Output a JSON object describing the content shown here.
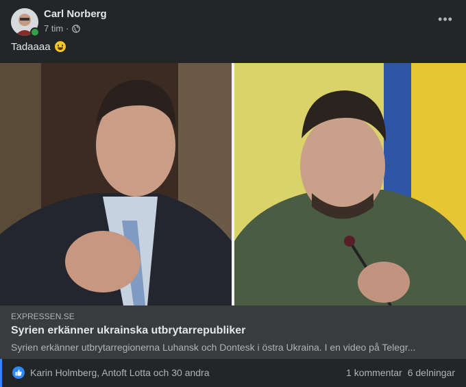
{
  "post": {
    "author": "Carl Norberg",
    "time": "7 tim",
    "separator": "·",
    "privacy_icon": "globe-icon",
    "text": "Tadaaaa",
    "emoji": "grinning-face-icon",
    "more_label": "•••"
  },
  "link": {
    "domain": "EXPRESSEN.SE",
    "title": "Syrien erkänner ukrainska utbrytarrepubliker",
    "description": "Syrien erkänner utbrytarregionerna Luhansk och Dontesk i östra Ukraina. I en video på Telegr..."
  },
  "footer": {
    "reaction_icon": "like-icon",
    "reactors": "Karin Holmberg, Antoft Lotta och 30 andra",
    "comments": "1 kommentar",
    "shares": "6 delningar"
  },
  "colors": {
    "background": "#242526",
    "card": "#3a3b3c",
    "accent": "#2d88ff",
    "online": "#31a24c"
  }
}
